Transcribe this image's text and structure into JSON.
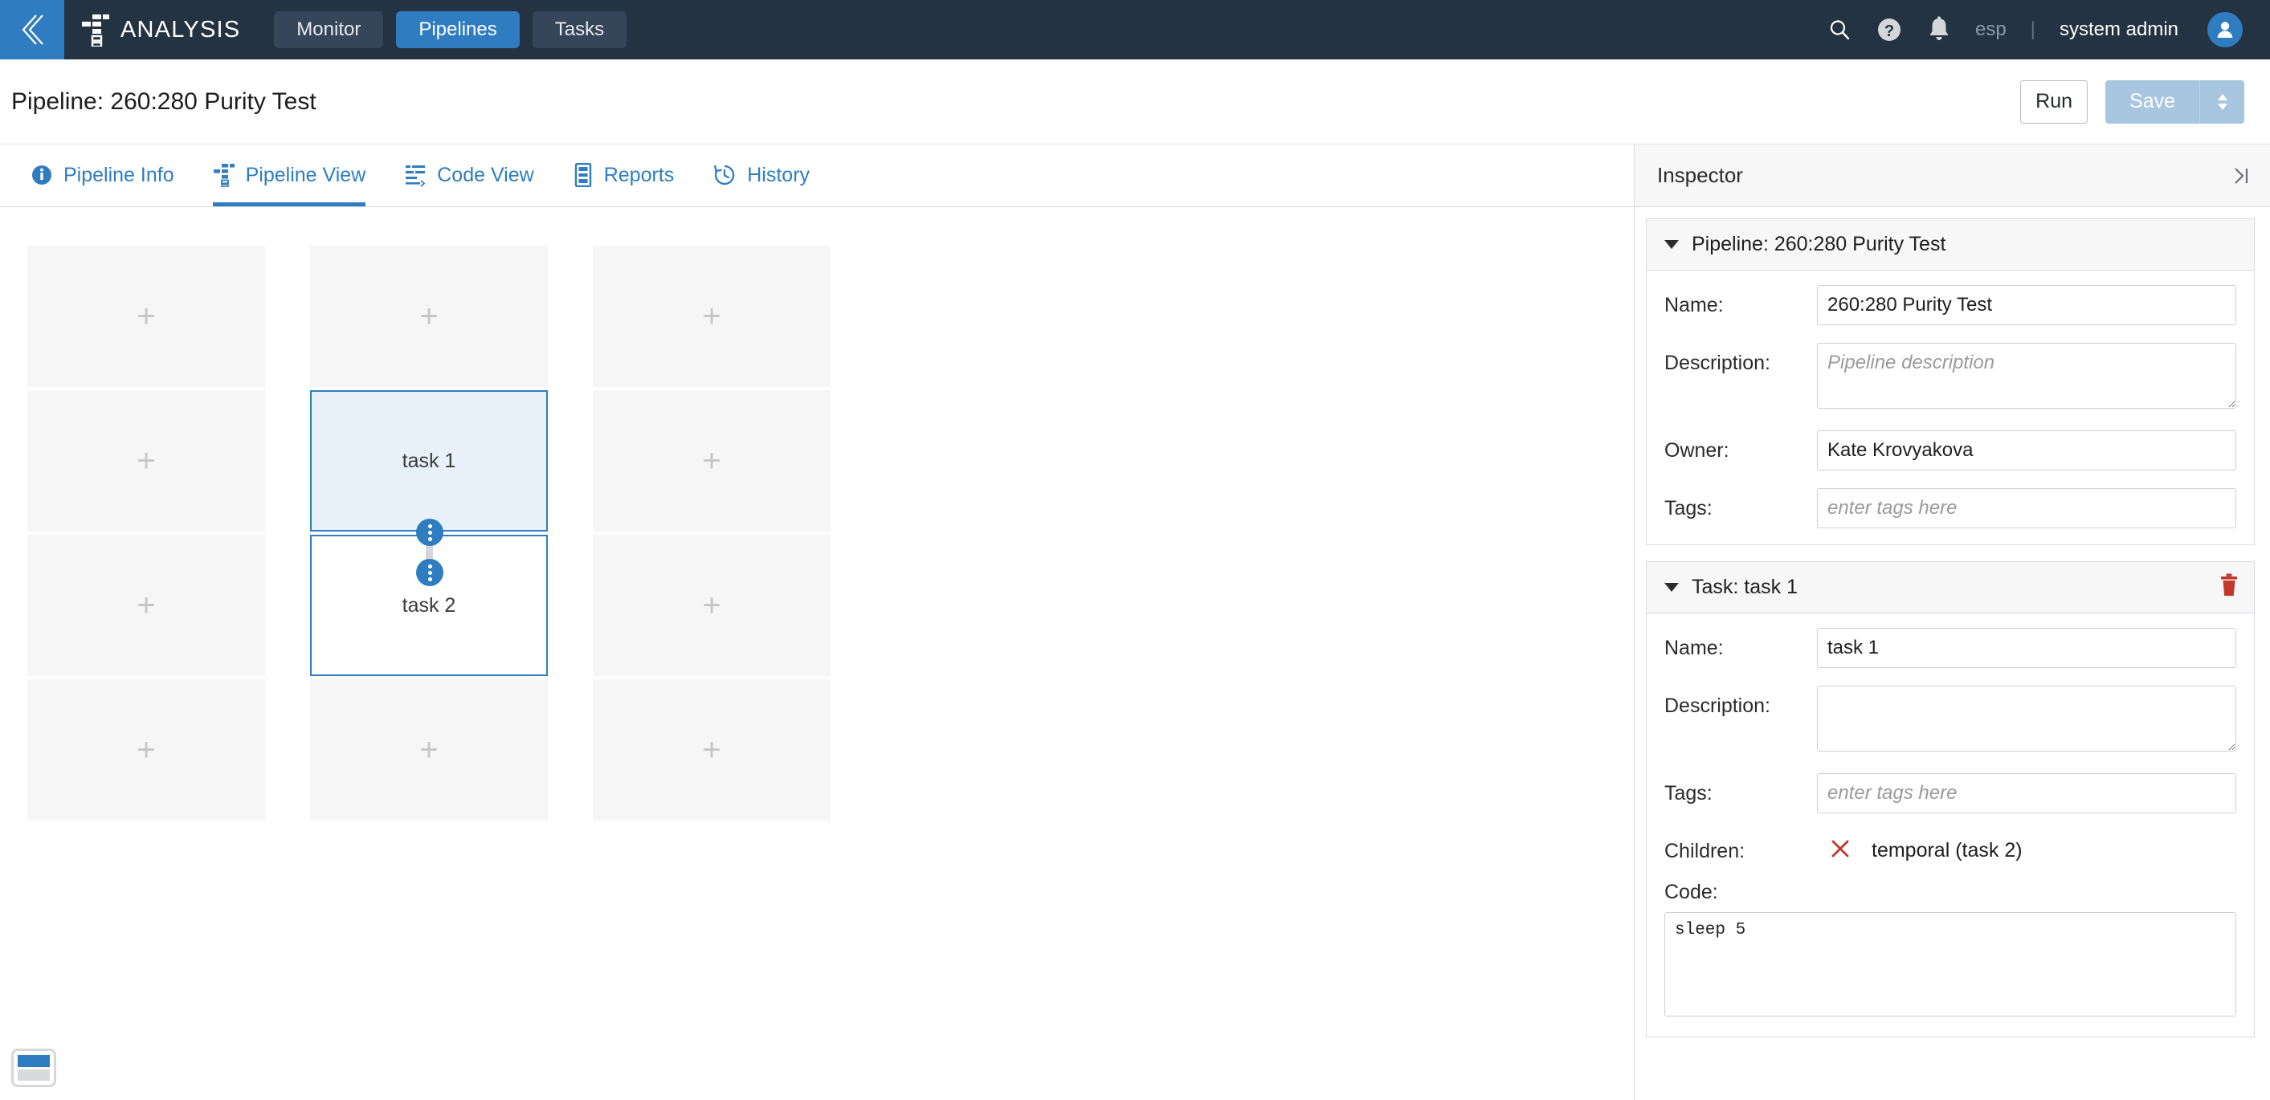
{
  "topbar": {
    "back_icon": "chevron-left-icon",
    "brand": "ANALYSIS",
    "brand_logo_icon": "pipeline-tree-logo-icon",
    "tabs": [
      {
        "label": "Monitor",
        "active": false
      },
      {
        "label": "Pipelines",
        "active": true
      },
      {
        "label": "Tasks",
        "active": false
      }
    ],
    "search_icon": "search-icon",
    "help_icon": "help-circle-icon",
    "notifications_icon": "bell-icon",
    "org": "esp",
    "separator": "|",
    "user": "system admin",
    "avatar_icon": "user-avatar-icon",
    "bg_color": "#243342",
    "accent_color": "#2f7dc0"
  },
  "titlebar": {
    "title": "Pipeline: 260:280 Purity Test",
    "run_label": "Run",
    "save_label": "Save",
    "save_caret_icon": "caret-updown-icon"
  },
  "content_tabs": [
    {
      "label": "Pipeline Info",
      "icon": "info-circle-icon",
      "active": false
    },
    {
      "label": "Pipeline View",
      "icon": "pipeline-tree-icon",
      "active": true
    },
    {
      "label": "Code View",
      "icon": "code-lines-icon",
      "active": false
    },
    {
      "label": "Reports",
      "icon": "report-document-icon",
      "active": false
    },
    {
      "label": "History",
      "icon": "clock-history-icon",
      "active": false
    }
  ],
  "canvas": {
    "slot_plus": "+",
    "inline_add": "+",
    "minimap_icon": "minimap-layout-icon",
    "nodes": [
      {
        "label": "task 1",
        "selected": true,
        "col": 1,
        "row": 1
      },
      {
        "label": "task 2",
        "selected": false,
        "col": 1,
        "row": 2
      }
    ],
    "node_border_color": "#2f7dc0",
    "node_selected_fill": "#e8f1fa",
    "slot_fill": "#f6f6f6"
  },
  "inspector": {
    "title": "Inspector",
    "collapse_icon": "collapse-right-icon",
    "pipeline_card": {
      "header": "Pipeline: 260:280 Purity Test",
      "fields": [
        {
          "label": "Name:",
          "value": "260:280 Purity Test",
          "placeholder": "",
          "type": "input"
        },
        {
          "label": "Description:",
          "value": "",
          "placeholder": "Pipeline description",
          "type": "textarea"
        },
        {
          "label": "Owner:",
          "value": "Kate Krovyakova",
          "placeholder": "",
          "type": "input"
        },
        {
          "label": "Tags:",
          "value": "",
          "placeholder": "enter tags here",
          "type": "input"
        }
      ]
    },
    "task_card": {
      "header": "Task: task 1",
      "delete_icon": "trash-icon",
      "delete_color": "#c0392b",
      "fields": [
        {
          "label": "Name:",
          "value": "task 1",
          "placeholder": "",
          "type": "input"
        },
        {
          "label": "Description:",
          "value": "",
          "placeholder": "",
          "type": "textarea"
        },
        {
          "label": "Tags:",
          "value": "",
          "placeholder": "enter tags here",
          "type": "input"
        }
      ],
      "children_label": "Children:",
      "children": [
        {
          "label": "temporal (task 2)",
          "remove_icon": "x-remove-icon"
        }
      ],
      "code_label": "Code:",
      "code_value": "sleep 5"
    }
  }
}
